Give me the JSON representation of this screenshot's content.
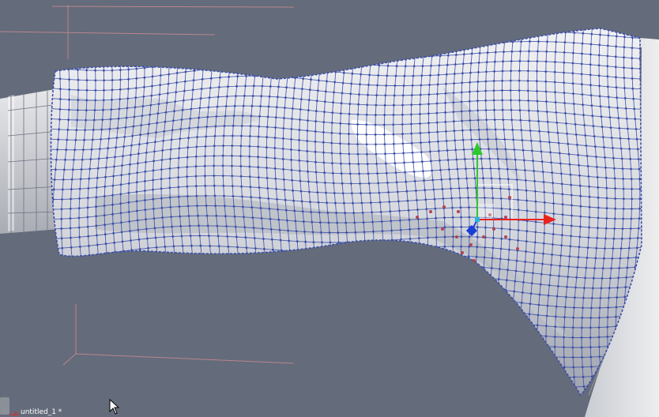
{
  "scene": {
    "document_title": "untitled_1 *",
    "background_color": "#646b7a",
    "mesh_color": "#3c4fa8",
    "surface_color": "#d9dbe0",
    "grid_line_color": "#c98a92"
  },
  "gizmo": {
    "type": "translate",
    "axes": [
      {
        "name": "x",
        "color": "#e8231e"
      },
      {
        "name": "y",
        "color": "#2ec72e"
      },
      {
        "name": "z",
        "color": "#1a3fd6"
      }
    ]
  },
  "status_bar": {
    "axis_indicator": "x"
  }
}
